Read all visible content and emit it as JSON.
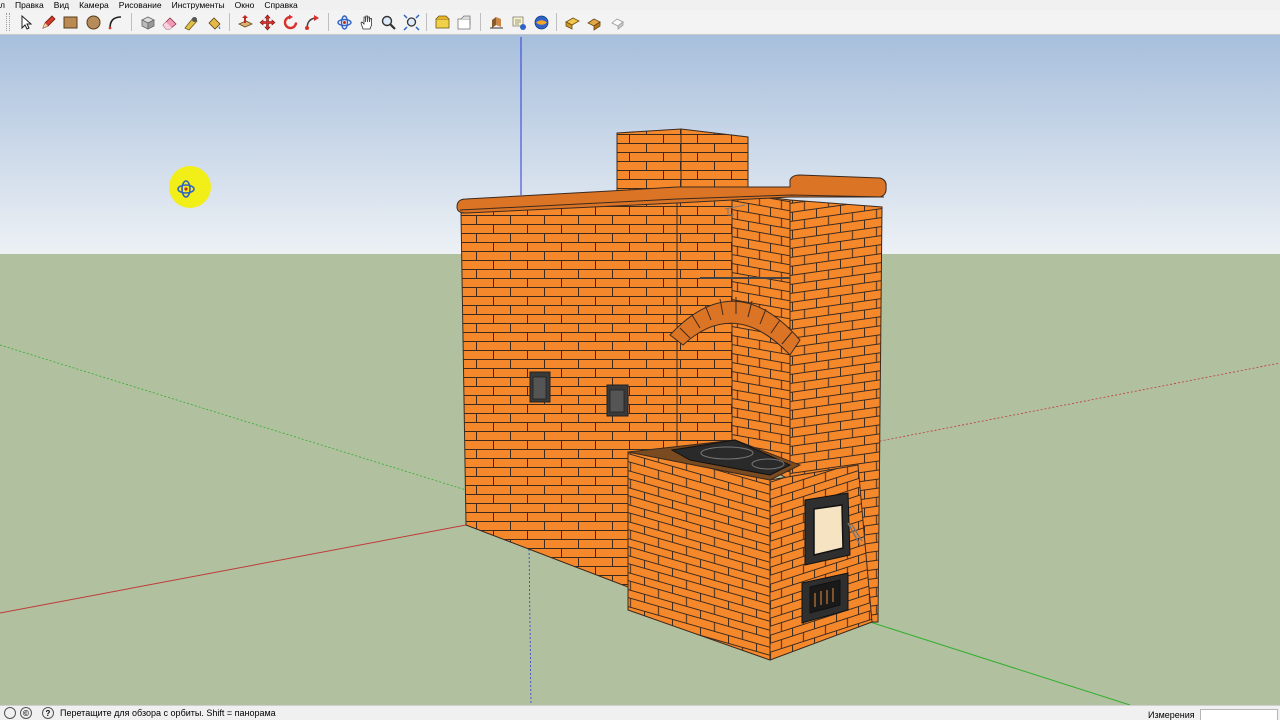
{
  "menu": {
    "items": [
      "л",
      "Правка",
      "Вид",
      "Камера",
      "Рисование",
      "Инструменты",
      "Окно",
      "Справка"
    ]
  },
  "toolbar": {
    "tools": [
      {
        "name": "select-tool",
        "icon": "arrow-icon"
      },
      {
        "name": "pencil-tool",
        "icon": "pencil-icon"
      },
      {
        "name": "rectangle-tool",
        "icon": "rectangle-icon"
      },
      {
        "name": "circle-tool",
        "icon": "circle-icon"
      },
      {
        "name": "arc-tool",
        "icon": "arc-icon"
      },
      {
        "name": "make-component-tool",
        "icon": "component-icon"
      },
      {
        "name": "eraser-tool",
        "icon": "eraser-icon"
      },
      {
        "name": "tape-measure-tool",
        "icon": "tape-icon"
      },
      {
        "name": "paint-bucket-tool",
        "icon": "paint-bucket-icon"
      },
      {
        "name": "push-pull-tool",
        "icon": "push-pull-icon"
      },
      {
        "name": "move-tool",
        "icon": "move-icon"
      },
      {
        "name": "rotate-tool",
        "icon": "rotate-icon"
      },
      {
        "name": "follow-me-tool",
        "icon": "follow-me-icon"
      },
      {
        "name": "orbit-tool",
        "icon": "orbit-icon"
      },
      {
        "name": "pan-tool",
        "icon": "hand-icon"
      },
      {
        "name": "zoom-tool",
        "icon": "magnifier-icon"
      },
      {
        "name": "zoom-extents-tool",
        "icon": "zoom-extents-icon"
      },
      {
        "name": "warehouse-tool",
        "icon": "warehouse-icon"
      },
      {
        "name": "share-model-tool",
        "icon": "share-icon"
      },
      {
        "name": "get-models-tool",
        "icon": "get-models-icon"
      },
      {
        "name": "components-tool",
        "icon": "components-icon"
      },
      {
        "name": "extension-tool",
        "icon": "extension-icon"
      },
      {
        "name": "layout-tool",
        "icon": "layout-icon"
      },
      {
        "name": "styles-tool",
        "icon": "styles-icon"
      },
      {
        "name": "shadows-tool",
        "icon": "shadow-icon"
      }
    ]
  },
  "colors": {
    "sky_top": "#a7bfdc",
    "sky_bottom": "#edf1f5",
    "ground": "#b1c09e",
    "brick": "#f6882c",
    "brick_dark": "#db7424",
    "mortar": "#3c2a1e",
    "axis_red": "#c03a3a",
    "axis_green": "#2eb02e",
    "axis_blue": "#2c3ad8",
    "cursor": "#f2ee18"
  },
  "status": {
    "hint": "Перетащите для обзора с орбиты.  Shift = панорама",
    "measure_label": "Измерения",
    "measure_value": ""
  }
}
